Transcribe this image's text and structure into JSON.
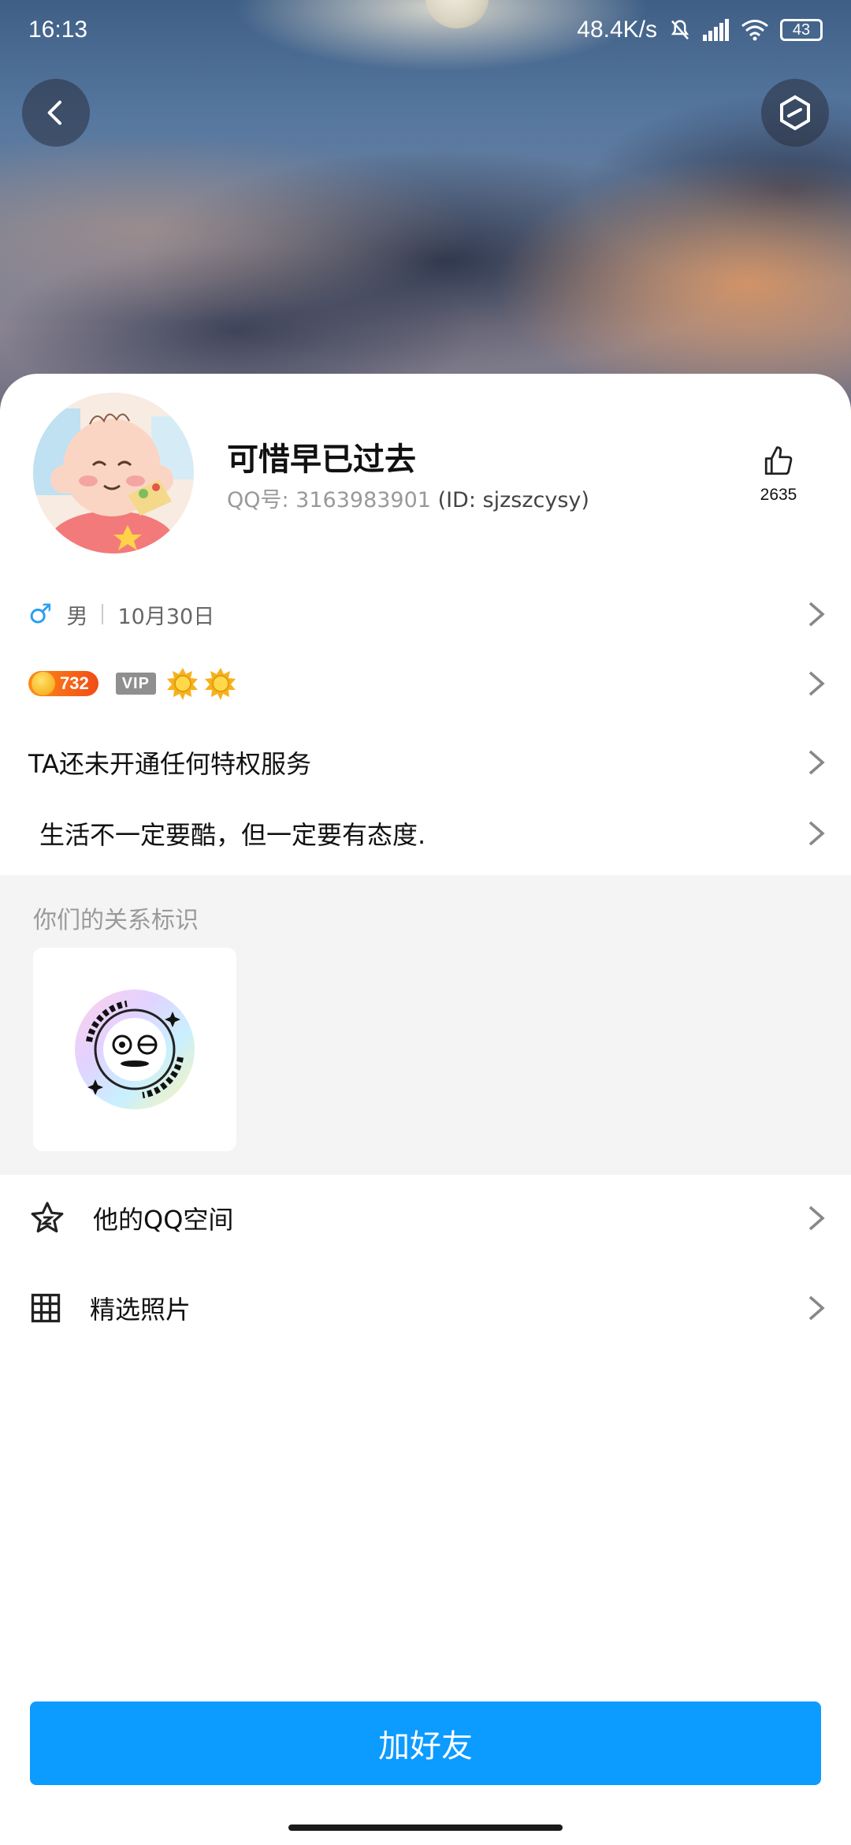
{
  "status_bar": {
    "time": "16:13",
    "net_speed": "48.4K/s",
    "battery": "43"
  },
  "profile": {
    "nickname": "可惜早已过去",
    "qq_label": "QQ号: 3163983901",
    "id_label": "(ID: sjzszcysy)",
    "likes": "2635",
    "gender_symbol": "♂",
    "gender": "男",
    "birthday": "10月30日",
    "level": "732",
    "vip_label": "VIP",
    "privilege_text": "TA还未开通任何特权服务",
    "signature": "生活不一定要酷，但一定要有态度."
  },
  "relation": {
    "title": "你们的关系标识"
  },
  "menu": {
    "qzone": "他的QQ空间",
    "photos": "精选照片"
  },
  "actions": {
    "add_friend": "加好友"
  },
  "colors": {
    "accent": "#0c9bff",
    "gender_blue": "#2aa0f0",
    "level_orange": "#f04c18"
  }
}
